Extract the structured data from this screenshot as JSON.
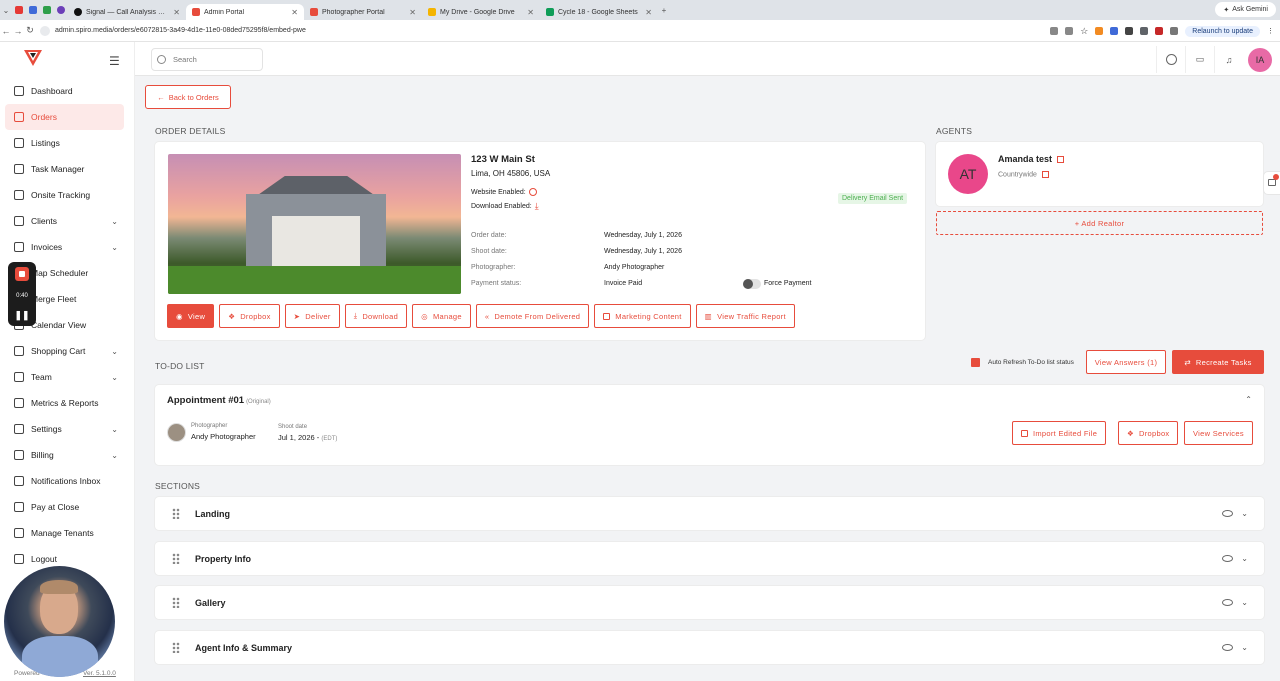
{
  "browser": {
    "tabs": [
      {
        "title": "Signal — Call Analysis & Coa"
      },
      {
        "title": "Admin Portal"
      },
      {
        "title": "Photographer Portal"
      },
      {
        "title": "My Drive - Google Drive"
      },
      {
        "title": "Cycle 18 - Google Sheets"
      }
    ],
    "ask_gemini": "Ask Gemini",
    "url": "admin.spiro.media/orders/e6072815-3a49-4d1e-11e0-08ded75295f8/embed-pwe",
    "relaunch": "Relaunch to update"
  },
  "sidebar": {
    "items": [
      {
        "label": "Dashboard",
        "icon": "monitor-icon"
      },
      {
        "label": "Orders",
        "icon": "cart-icon",
        "active": true
      },
      {
        "label": "Listings",
        "icon": "home-icon"
      },
      {
        "label": "Task Manager",
        "icon": "tasks-icon"
      },
      {
        "label": "Onsite Tracking",
        "icon": "map-icon"
      },
      {
        "label": "Clients",
        "icon": "clients-icon",
        "chevron": true
      },
      {
        "label": "Invoices",
        "icon": "invoice-icon",
        "chevron": true
      },
      {
        "label": "Map Scheduler",
        "icon": "map-icon"
      },
      {
        "label": "Merge Fleet",
        "icon": "fleet-icon"
      },
      {
        "label": "Calendar View",
        "icon": "calendar-icon"
      },
      {
        "label": "Shopping Cart",
        "icon": "cart-icon",
        "chevron": true
      },
      {
        "label": "Team",
        "icon": "team-icon",
        "chevron": true
      },
      {
        "label": "Metrics & Reports",
        "icon": "chart-icon"
      },
      {
        "label": "Settings",
        "icon": "gear-icon",
        "chevron": true
      },
      {
        "label": "Billing",
        "icon": "billing-icon",
        "chevron": true
      },
      {
        "label": "Notifications Inbox",
        "icon": "bell-icon"
      },
      {
        "label": "Pay at Close",
        "icon": "dollar-icon"
      },
      {
        "label": "Manage Tenants",
        "icon": "tenants-icon"
      },
      {
        "label": "Logout",
        "icon": "logout-icon"
      }
    ],
    "powered": "Powered",
    "version": "Ver. 5.1.0.0"
  },
  "recorder": {
    "time": "0:40"
  },
  "topbar": {
    "search_placeholder": "Search",
    "avatar_initials": "IA"
  },
  "page": {
    "back": "Back to Orders",
    "order_details_title": "ORDER DETAILS",
    "agents_title": "AGENTS",
    "todo_title": "TO-DO LIST",
    "sections_title": "SECTIONS"
  },
  "order": {
    "address_line1": "123 W Main St",
    "address_line2": "Lima, OH 45806, USA",
    "website_enabled": "Website Enabled:",
    "download_enabled": "Download Enabled:",
    "status_badge": "Delivery Email Sent",
    "details": [
      {
        "label": "Order date:",
        "value": "Wednesday, July 1, 2026"
      },
      {
        "label": "Shoot date:",
        "value": "Wednesday, July 1, 2026"
      },
      {
        "label": "Photographer:",
        "value": "Andy Photographer"
      },
      {
        "label": "Payment status:",
        "value": "Invoice Paid"
      }
    ],
    "force_payment": "Force Payment",
    "actions": [
      "View",
      "Dropbox",
      "Deliver",
      "Download",
      "Manage",
      "Demote From Delivered",
      "Marketing Content",
      "View Traffic Report"
    ]
  },
  "agent": {
    "initials": "AT",
    "name": "Amanda test",
    "company": "Countrywide",
    "add_realtor": "+ Add Realtor"
  },
  "todo": {
    "auto_refresh": "Auto Refresh To-Do list status",
    "view_answers": "View Answers (1)",
    "recreate": "Recreate Tasks",
    "appointment_title": "Appointment #01",
    "appointment_sub": "(Original)",
    "photographer_label": "Photographer",
    "photographer_name": "Andy Photographer",
    "shoot_label": "Shoot date",
    "shoot_value": "Jul 1, 2026 -",
    "shoot_tz": "(EDT)",
    "import": "Import Edited File",
    "dropbox": "Dropbox",
    "services": "View Services"
  },
  "sections": [
    "Landing",
    "Property Info",
    "Gallery",
    "Agent Info & Summary"
  ],
  "colors": {
    "accent": "#e74c3c",
    "avatar": "#e86aa6",
    "agent_avatar": "#e9478a",
    "success": "#4caf50"
  }
}
